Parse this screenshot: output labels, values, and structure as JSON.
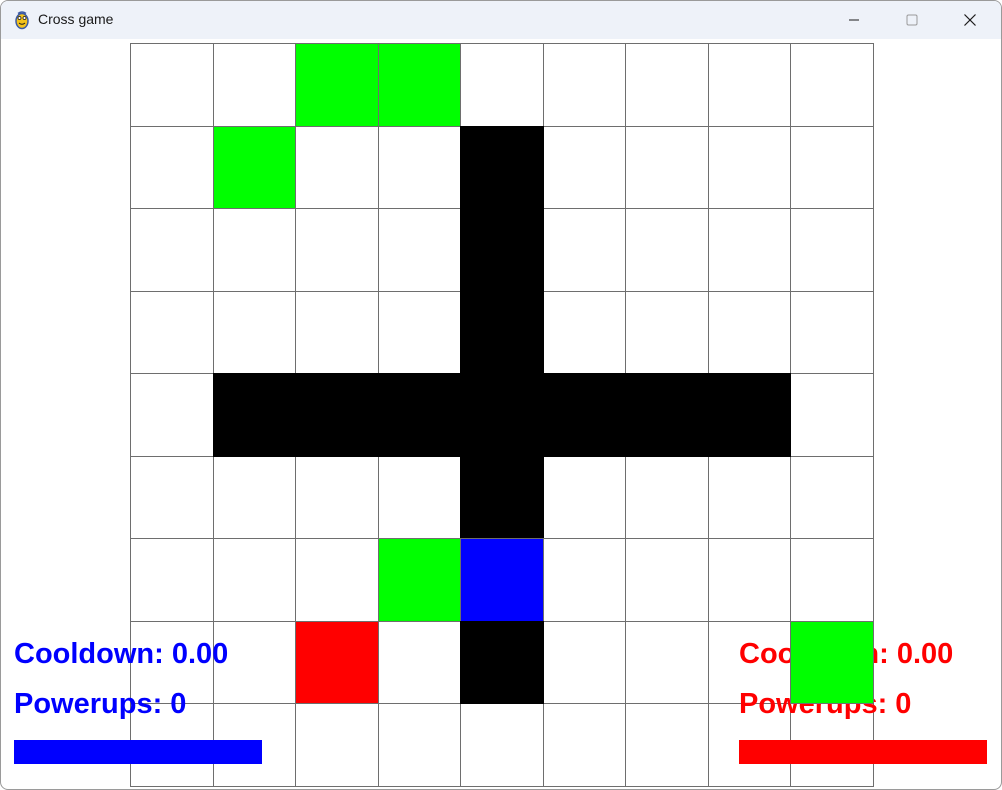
{
  "window": {
    "title": "Cross game",
    "app_icon": "pygame-snake-icon",
    "controls": [
      {
        "name": "minimize-button",
        "icon": "minimize-icon"
      },
      {
        "name": "maximize-button",
        "icon": "maximize-icon"
      },
      {
        "name": "close-button",
        "icon": "close-icon"
      }
    ]
  },
  "colors": {
    "empty": "#ffffff",
    "wall": "#000000",
    "powerup": "#00ff00",
    "blue_player": "#0000ff",
    "red_player": "#ff0000",
    "grid_line": "#6e6e6e"
  },
  "board": {
    "rows": 9,
    "cols": 9,
    "legend": {
      ".": "empty",
      "W": "wall",
      "G": "powerup",
      "B": "blue_player",
      "R": "red_player"
    },
    "cells": [
      ". . G G . . . . .",
      ". G . . W . . . .",
      ". . . . W . . . .",
      ". . . . W . . . .",
      ". W W W W W W W .",
      ". . . . W . . . .",
      ". . . G B . . . .",
      ". . R . W . . . G",
      ". . . . . . . . ."
    ]
  },
  "hud": {
    "blue": {
      "cooldown_text": "Cooldown: 0.00",
      "powerups_text": "Powerups: 0",
      "bar_fill": 1.0,
      "color": "#0000ff"
    },
    "red": {
      "cooldown_text": "Cooldown: 0.00",
      "powerups_text": "Powerups: 0",
      "bar_fill": 1.0,
      "color": "#ff0000"
    }
  }
}
